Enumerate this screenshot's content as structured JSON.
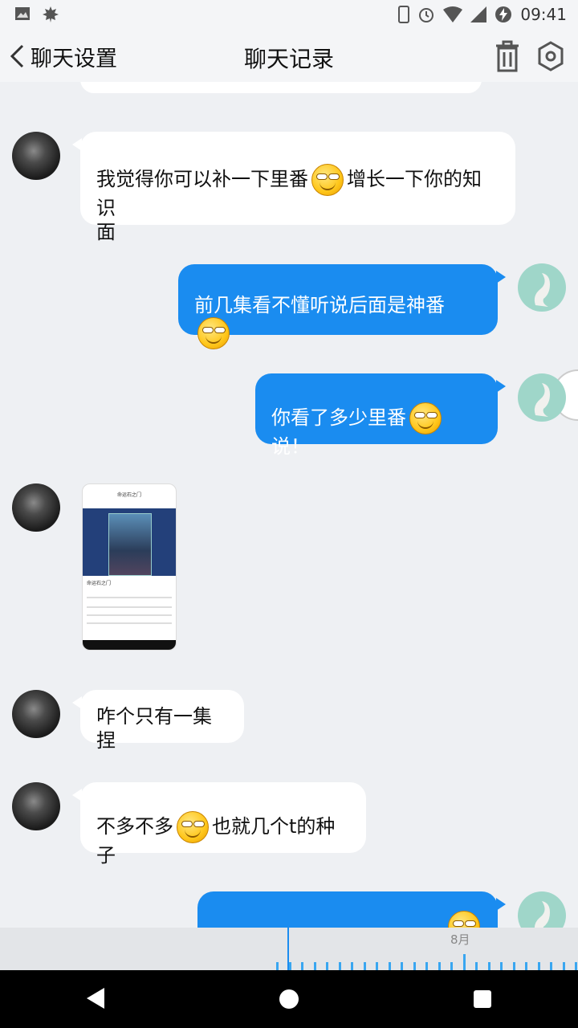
{
  "status_bar": {
    "time": "09:41"
  },
  "header": {
    "back_label": "聊天设置",
    "title": "聊天记录"
  },
  "messages": [
    {
      "text_a": "我觉得你可以补一下里番",
      "text_b": "增长一下你的知识",
      "text_c": "面"
    },
    {
      "text_a": "前几集看不懂听说后面是神番"
    },
    {
      "text_a": "你看了多少里番",
      "text_b": "说！"
    },
    {
      "thumb_title": "命运石之门",
      "thumb_name": "命运石之门"
    },
    {
      "text_a": "咋个只有一集捏"
    },
    {
      "text_a": "不多不多",
      "text_b": "也就几个t的种子"
    }
  ],
  "timeline": {
    "month": "8月"
  }
}
